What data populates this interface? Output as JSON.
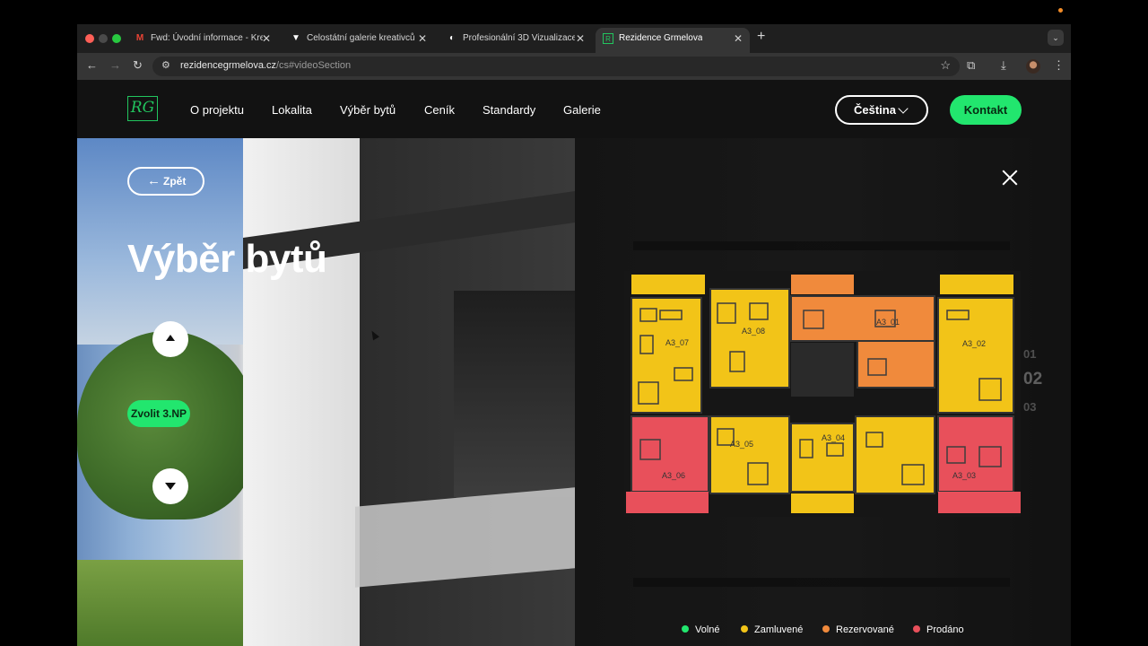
{
  "browser": {
    "tabs": [
      {
        "label": "Fwd: Úvodní informace - Krea",
        "favicon": "gmail-icon"
      },
      {
        "label": "Celostátní galerie kreativců",
        "favicon": "v-logo-icon"
      },
      {
        "label": "Profesionální 3D Vizualizace",
        "favicon": "circle-logo-icon"
      },
      {
        "label": "Rezidence Grmelova",
        "favicon": "rg-logo-icon",
        "active": true
      }
    ],
    "url": {
      "domain": "rezidencegrmelova.cz",
      "path": "/cs#videoSection"
    }
  },
  "site": {
    "logo_text": "RG",
    "nav": [
      "O projektu",
      "Lokalita",
      "Výběr bytů",
      "Ceník",
      "Standardy",
      "Galerie"
    ],
    "language_label": "Čeština",
    "contact_label": "Kontakt"
  },
  "hero": {
    "back_label": "Zpět",
    "title": "Výběr bytů",
    "select_floor_label": "Zvolit 3.NP",
    "floor_index": [
      "01",
      "02",
      "03"
    ]
  },
  "floorplan": {
    "units": [
      {
        "id": "A3_07",
        "status": "Zamluvené"
      },
      {
        "id": "A3_08",
        "status": "Zamluvené"
      },
      {
        "id": "A3_01",
        "status": "Rezervované"
      },
      {
        "id": "A3_02",
        "status": "Zamluvené"
      },
      {
        "id": "A3_06",
        "status": "Prodáno"
      },
      {
        "id": "A3_05",
        "status": "Zamluvené"
      },
      {
        "id": "A3_04",
        "status": "Zamluvené"
      },
      {
        "id": "A3_03",
        "status": "Prodáno"
      }
    ]
  },
  "legend": [
    {
      "label": "Volné",
      "color": "#22e66e"
    },
    {
      "label": "Zamluvené",
      "color": "#f2c418"
    },
    {
      "label": "Rezervované",
      "color": "#f08a3c"
    },
    {
      "label": "Prodáno",
      "color": "#e8505b"
    }
  ],
  "colors": {
    "accent": "#22e66e",
    "reserved_yellow": "#f2c418",
    "reservation_orange": "#f08a3c",
    "sold_red": "#e8505b"
  }
}
